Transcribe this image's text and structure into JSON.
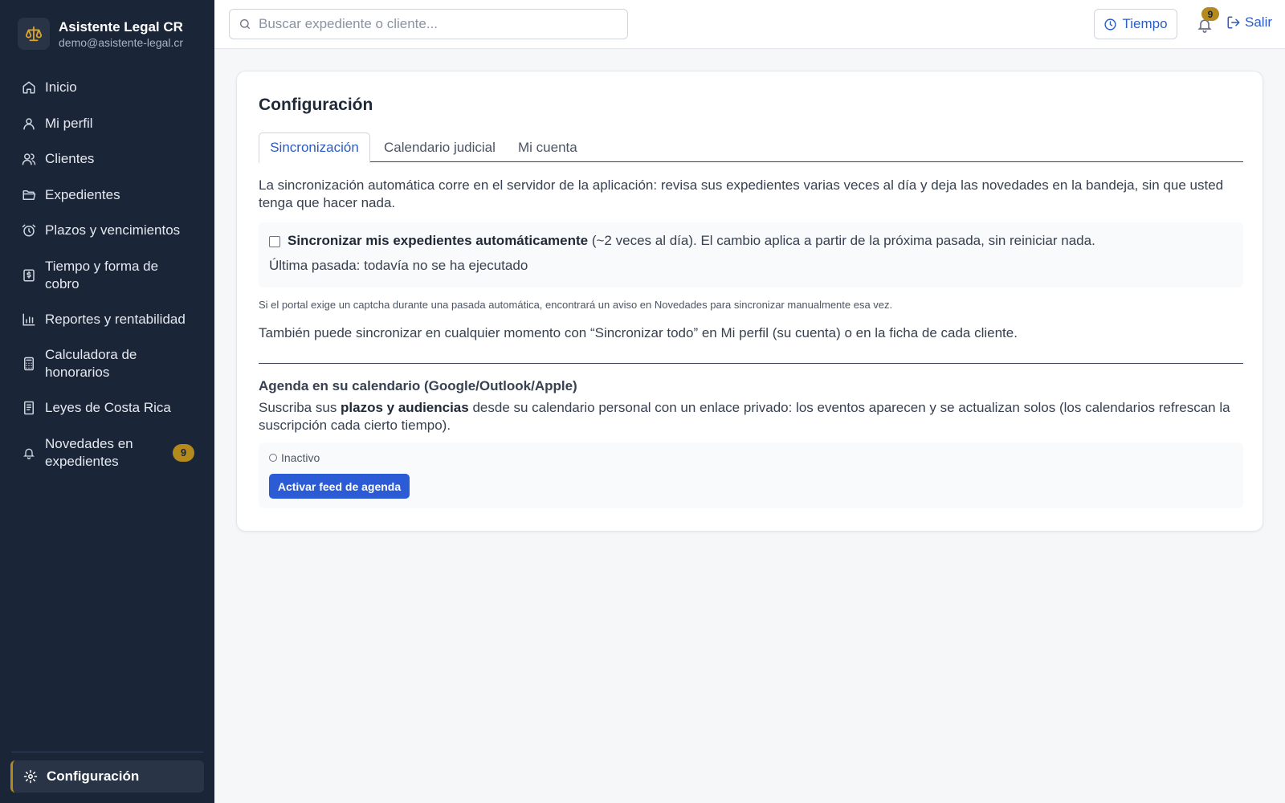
{
  "brand": {
    "name": "Asistente Legal CR",
    "email": "demo@asistente-legal.cr"
  },
  "sidebar": {
    "items": [
      {
        "label": "Inicio",
        "icon": "home-icon"
      },
      {
        "label": "Mi perfil",
        "icon": "user-icon"
      },
      {
        "label": "Clientes",
        "icon": "users-icon"
      },
      {
        "label": "Expedientes",
        "icon": "folder-icon"
      },
      {
        "label": "Plazos y vencimientos",
        "icon": "alarm-clock-icon"
      },
      {
        "label": "Tiempo y forma de cobro",
        "icon": "receipt-icon"
      },
      {
        "label": "Reportes y rentabilidad",
        "icon": "bar-chart-icon"
      },
      {
        "label": "Calculadora de honorarios",
        "icon": "calculator-icon"
      },
      {
        "label": "Leyes de Costa Rica",
        "icon": "book-icon"
      },
      {
        "label": "Novedades en expedientes",
        "icon": "bell-icon",
        "badge": "9"
      }
    ],
    "active": {
      "label": "Configuración",
      "icon": "gear-icon"
    },
    "accent_color": "#b58a1c",
    "background": "#1a2538"
  },
  "topbar": {
    "search_placeholder": "Buscar expediente o cliente...",
    "tiempo_label": "Tiempo",
    "notifications_count": "9",
    "salir_label": "Salir"
  },
  "main": {
    "title": "Configuración",
    "tabs": [
      {
        "label": "Sincronización",
        "active": true
      },
      {
        "label": "Calendario judicial",
        "active": false
      },
      {
        "label": "Mi cuenta",
        "active": false
      }
    ],
    "intro": "La sincronización automática corre en el servidor de la aplicación: revisa sus expedientes varias veces al día y deja las novedades en la bandeja, sin que usted tenga que hacer nada.",
    "sync": {
      "checkbox_checked": false,
      "label_bold": "Sincronizar mis expedientes automáticamente",
      "label_rest": " (~2 veces al día). El cambio aplica a partir de la próxima pasada, sin reiniciar nada.",
      "last_run": "Última pasada: todavía no se ha ejecutado"
    },
    "captcha_note": "Si el portal exige un captcha durante una pasada automática, encontrará un aviso en Novedades para sincronizar manualmente esa vez.",
    "manual_note": "También puede sincronizar en cualquier momento con “Sincronizar todo” en Mi perfil (su cuenta) o en la ficha de cada cliente.",
    "agenda": {
      "title": "Agenda en su calendario (Google/Outlook/Apple)",
      "desc_pre": "Suscriba sus ",
      "desc_bold": "plazos y audiencias",
      "desc_post": " desde su calendario personal con un enlace privado: los eventos aparecen y se actualizan solos (los calendarios refrescan la suscripción cada cierto tiempo).",
      "status": "Inactivo",
      "button": "Activar feed de agenda"
    },
    "primary_color": "#2b5cd6",
    "link_color": "#2b5cc2"
  }
}
